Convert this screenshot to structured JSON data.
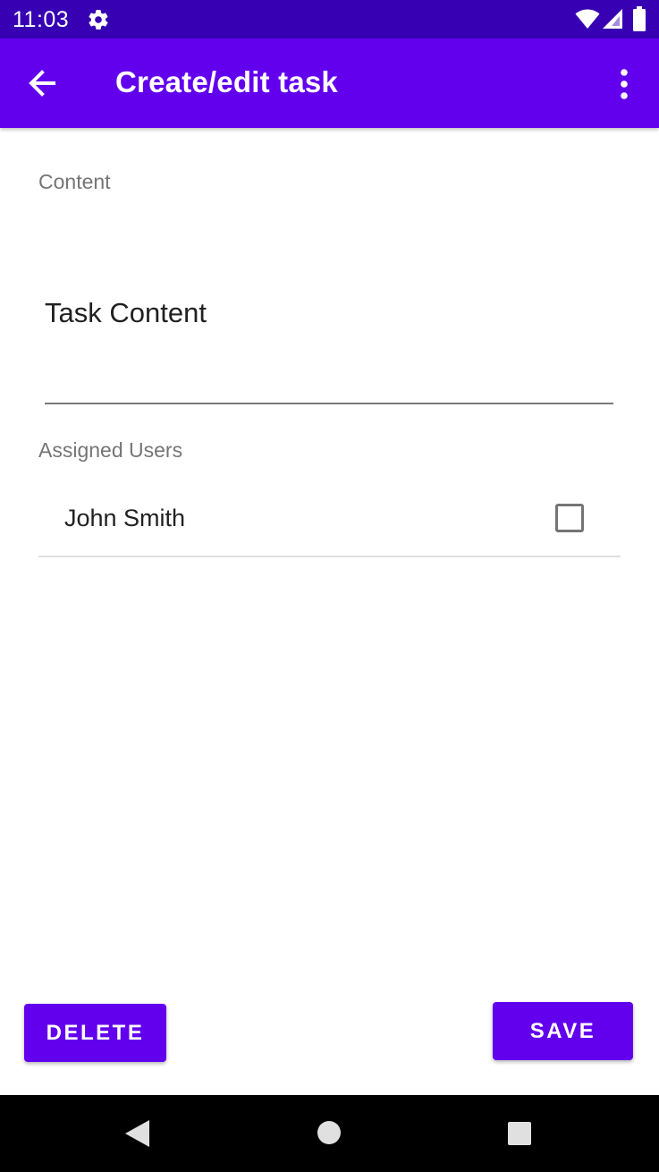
{
  "status_bar": {
    "time": "11:03",
    "icons": [
      "gear-icon",
      "wifi-icon",
      "signal-icon",
      "battery-icon"
    ],
    "background_color": "#3700b3"
  },
  "app_bar": {
    "title": "Create/edit task",
    "back_icon": "arrow-left-icon",
    "menu_icon": "more-vert-icon",
    "background_color": "#6200ee"
  },
  "content_section": {
    "label": "Content",
    "task_input": {
      "value": "",
      "placeholder": "Task Content"
    }
  },
  "users_section": {
    "label": "Assigned Users",
    "users": [
      {
        "name": "John Smith",
        "checked": false
      }
    ]
  },
  "actions": {
    "delete_label": "DELETE",
    "save_label": "SAVE",
    "button_color": "#6200ee"
  },
  "nav_bar": {
    "icons": [
      "nav-back-icon",
      "nav-home-icon",
      "nav-recents-icon"
    ]
  }
}
